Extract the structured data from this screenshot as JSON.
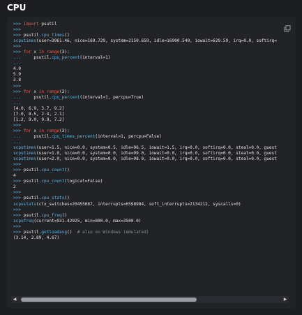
{
  "title": "CPU",
  "copy_icon": "copy-icon",
  "lines": [
    [
      [
        "p",
        ">>> "
      ],
      [
        "k",
        "import"
      ],
      [
        "o",
        " psutil"
      ]
    ],
    [
      [
        "p",
        ">>>"
      ]
    ],
    [
      [
        "p",
        ">>> "
      ],
      [
        "o",
        "psutil."
      ],
      [
        "f",
        "cpu_times"
      ],
      [
        "o",
        "()"
      ]
    ],
    [
      [
        "f",
        "scputimes"
      ],
      [
        "o",
        "(user=3961.46, nice=169.729, system=2150.659, idle=16900.540, iowait=629.59, irq=0.0, softirq="
      ]
    ],
    [
      [
        "p",
        ">>>"
      ]
    ],
    [
      [
        "p",
        ">>> "
      ],
      [
        "k",
        "for"
      ],
      [
        "o",
        " x "
      ],
      [
        "k",
        "in"
      ],
      [
        "o",
        " "
      ],
      [
        "k",
        "range"
      ],
      [
        "o",
        "(3):"
      ]
    ],
    [
      [
        "p",
        "..."
      ],
      [
        "o",
        "     psutil."
      ],
      [
        "f",
        "cpu_percent"
      ],
      [
        "o",
        "(interval=1)"
      ]
    ],
    [
      [
        "p",
        "..."
      ]
    ],
    [
      [
        "o",
        "4.0"
      ]
    ],
    [
      [
        "o",
        "5.9"
      ]
    ],
    [
      [
        "o",
        "3.8"
      ]
    ],
    [
      [
        "p",
        ">>>"
      ]
    ],
    [
      [
        "p",
        ">>> "
      ],
      [
        "k",
        "for"
      ],
      [
        "o",
        " x "
      ],
      [
        "k",
        "in"
      ],
      [
        "o",
        " "
      ],
      [
        "k",
        "range"
      ],
      [
        "o",
        "(3):"
      ]
    ],
    [
      [
        "p",
        "..."
      ],
      [
        "o",
        "     psutil."
      ],
      [
        "f",
        "cpu_percent"
      ],
      [
        "o",
        "(interval=1, percpu=True)"
      ]
    ],
    [
      [
        "p",
        "..."
      ]
    ],
    [
      [
        "o",
        "[4.0, 6.9, 3.7, 9.2]"
      ]
    ],
    [
      [
        "o",
        "[7.0, 8.5, 2.4, 2.1]"
      ]
    ],
    [
      [
        "o",
        "[1.2, 9.0, 9.9, 7.2]"
      ]
    ],
    [
      [
        "p",
        ">>>"
      ]
    ],
    [
      [
        "p",
        ">>> "
      ],
      [
        "k",
        "for"
      ],
      [
        "o",
        " x "
      ],
      [
        "k",
        "in"
      ],
      [
        "o",
        " "
      ],
      [
        "k",
        "range"
      ],
      [
        "o",
        "(3):"
      ]
    ],
    [
      [
        "p",
        "..."
      ],
      [
        "o",
        "     psutil."
      ],
      [
        "f",
        "cpu_times_percent"
      ],
      [
        "o",
        "(interval=1, percpu=False)"
      ]
    ],
    [
      [
        "p",
        "..."
      ]
    ],
    [
      [
        "f",
        "scputimes"
      ],
      [
        "o",
        "(user=1.5, nice=0.0, system=0.5, idle=96.5, iowait=1.5, irq=0.0, softirq=0.0, steal=0.0, guest"
      ]
    ],
    [
      [
        "f",
        "scputimes"
      ],
      [
        "o",
        "(user=1.0, nice=0.0, system=0.0, idle=99.0, iowait=0.0, irq=0.0, softirq=0.0, steal=0.0, guest"
      ]
    ],
    [
      [
        "f",
        "scputimes"
      ],
      [
        "o",
        "(user=2.0, nice=0.0, system=0.0, idle=98.0, iowait=0.0, irq=0.0, softirq=0.0, steal=0.0, guest"
      ]
    ],
    [
      [
        "p",
        ">>>"
      ]
    ],
    [
      [
        "p",
        ">>> "
      ],
      [
        "o",
        "psutil."
      ],
      [
        "f",
        "cpu_count"
      ],
      [
        "o",
        "()"
      ]
    ],
    [
      [
        "o",
        "4"
      ]
    ],
    [
      [
        "p",
        ">>> "
      ],
      [
        "o",
        "psutil."
      ],
      [
        "f",
        "cpu_count"
      ],
      [
        "o",
        "(logical=False)"
      ]
    ],
    [
      [
        "o",
        "2"
      ]
    ],
    [
      [
        "p",
        ">>>"
      ]
    ],
    [
      [
        "p",
        ">>> "
      ],
      [
        "o",
        "psutil."
      ],
      [
        "f",
        "cpu_stats"
      ],
      [
        "o",
        "()"
      ]
    ],
    [
      [
        "f",
        "scpustats"
      ],
      [
        "o",
        "(ctx_switches=20455687, interrupts=6598984, soft_interrupts=2134212, syscalls=0)"
      ]
    ],
    [
      [
        "p",
        ">>>"
      ]
    ],
    [
      [
        "p",
        ">>> "
      ],
      [
        "o",
        "psutil."
      ],
      [
        "f",
        "cpu_freq"
      ],
      [
        "o",
        "()"
      ]
    ],
    [
      [
        "f",
        "scpufreq"
      ],
      [
        "o",
        "(current=931.42925, min=800.0, max=3500.0)"
      ]
    ],
    [
      [
        "p",
        ">>>"
      ]
    ],
    [
      [
        "p",
        ">>> "
      ],
      [
        "o",
        "psutil."
      ],
      [
        "f",
        "getloadavg"
      ],
      [
        "o",
        "()  "
      ],
      [
        "c",
        "# also on Windows (emulated)"
      ]
    ],
    [
      [
        "o",
        "(3.14, 3.89, 4.67)"
      ]
    ]
  ],
  "scrollbar": {
    "left_arrow": "◀",
    "right_arrow": "▶",
    "position_fraction": 0.0,
    "visible_fraction": 0.68
  }
}
